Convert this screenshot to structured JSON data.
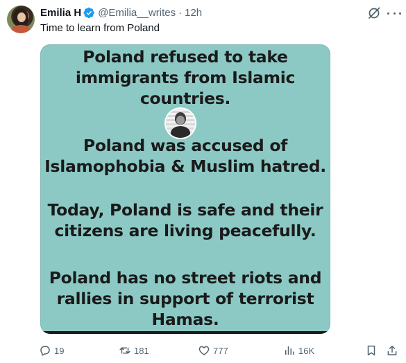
{
  "author": {
    "name": "Emilia H",
    "handle": "@Emilia__writes",
    "separator": "·",
    "time": "12h"
  },
  "tweet": {
    "text": "Time to learn from Poland"
  },
  "media": {
    "background_color": "#8cc9c5",
    "paragraphs": [
      [
        "Poland refused to take",
        "immigrants from Islamic",
        "countries."
      ],
      [
        "Poland was accused of",
        "Islamophobia & Muslim hatred."
      ],
      [
        "Today, Poland is safe and their",
        "citizens are living peacefully."
      ],
      [
        "Poland has no street riots and",
        "rallies in support of terrorist",
        "Hamas."
      ]
    ]
  },
  "actions": {
    "replies": "19",
    "reposts": "181",
    "likes": "777",
    "views": "16K"
  },
  "icons": {
    "verified": "verified-badge-icon",
    "grok": "grok-icon",
    "more": "more-icon",
    "reply": "reply-icon",
    "repost": "repost-icon",
    "like": "heart-icon",
    "views": "views-icon",
    "bookmark": "bookmark-icon",
    "share": "share-icon"
  },
  "colors": {
    "verified_blue": "#1d9bf0",
    "muted_text": "#536471",
    "text": "#0f1419"
  }
}
